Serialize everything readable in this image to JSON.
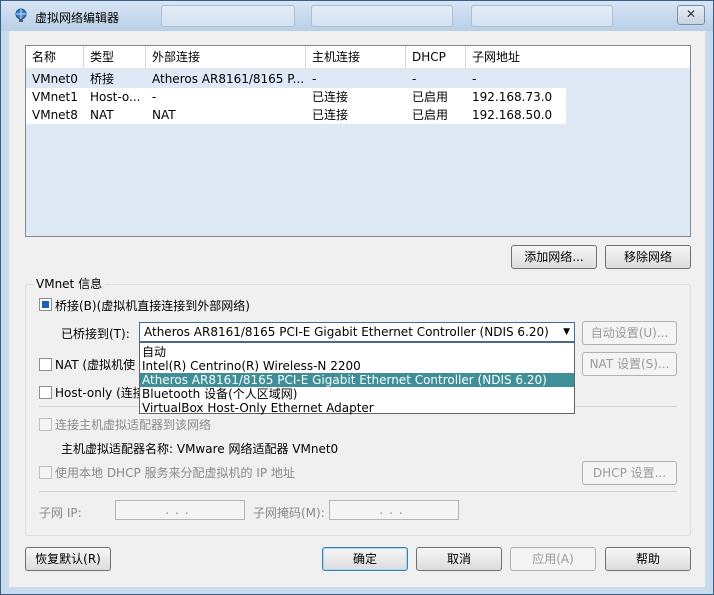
{
  "window": {
    "title": "虚拟网络编辑器",
    "close_label": "✕"
  },
  "network_table": {
    "columns": [
      "名称",
      "类型",
      "外部连接",
      "主机连接",
      "DHCP",
      "子网地址"
    ],
    "rows": [
      [
        "VMnet0",
        "桥接",
        "Atheros AR8161/8165 P...",
        "-",
        "-",
        "-"
      ],
      [
        "VMnet1",
        "Host-o...",
        "-",
        "已连接",
        "已启用",
        "192.168.73.0"
      ],
      [
        "VMnet8",
        "NAT",
        "NAT",
        "已连接",
        "已启用",
        "192.168.50.0"
      ]
    ]
  },
  "buttons": {
    "add_network": "添加网络...",
    "remove_network": "移除网络",
    "auto_settings": "自动设置(U)...",
    "nat_settings": "NAT 设置(S)...",
    "dhcp_settings": "DHCP 设置...",
    "restore_defaults": "恢复默认(R)",
    "ok": "确定",
    "cancel": "取消",
    "apply": "应用(A)",
    "help": "帮助"
  },
  "vmnet_info": {
    "legend": "VMnet 信息",
    "bridged_label": "桥接(B)(虚拟机直接连接到外部网络)",
    "bridged_to_label": "已桥接到(T):",
    "bridged_to_value": "Atheros AR8161/8165 PCI-E Gigabit Ethernet Controller (NDIS 6.20)",
    "nat_label": "NAT (虚拟机使",
    "hostonly_label": "Host-only (连接",
    "connect_host_adapter_label": "连接主机虚拟适配器到该网络",
    "host_adapter_name": "主机虚拟适配器名称: VMware 网络适配器 VMnet0",
    "use_dhcp_label": "使用本地 DHCP 服务来分配虚拟机的 IP 地址",
    "subnet_ip_label": "子网 IP:",
    "subnet_mask_label": "子网掩码(M):",
    "ip_placeholder": "...",
    "bridged_checked": true
  },
  "dropdown_options": [
    "自动",
    "Intel(R) Centrino(R) Wireless-N 2200",
    "Atheros AR8161/8165 PCI-E Gigabit Ethernet Controller (NDIS 6.20)",
    "Bluetooth 设备(个人区域网)",
    "VirtualBox Host-Only Ethernet Adapter"
  ],
  "colors": {
    "highlight": "#3e8f98",
    "selection": "#dfe9f5"
  }
}
